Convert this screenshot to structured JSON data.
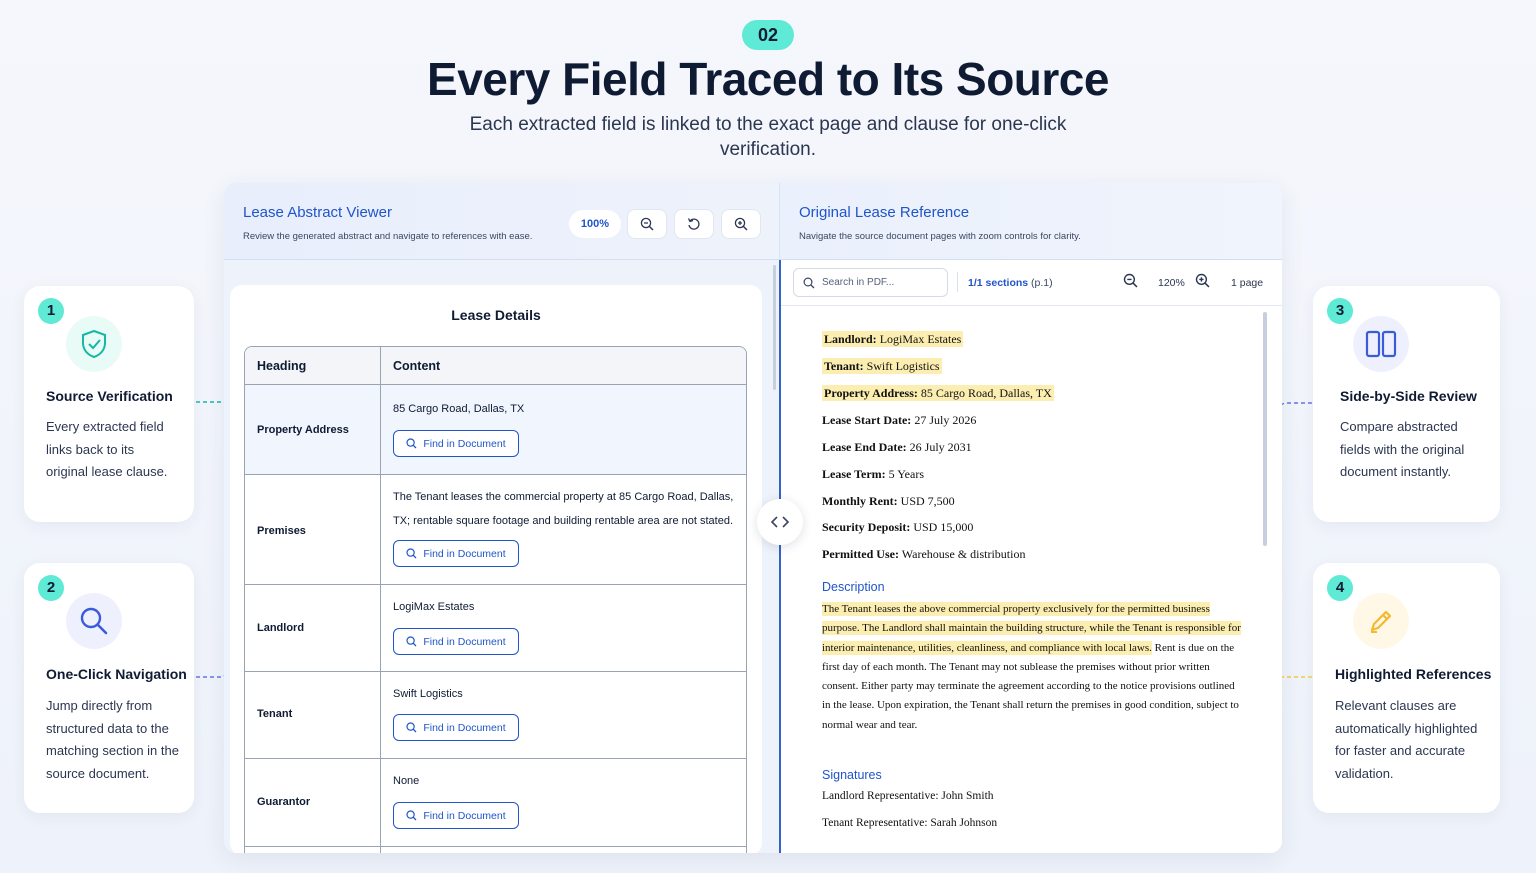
{
  "hero": {
    "badge": "02",
    "title": "Every Field Traced to Its Source",
    "subtitle": "Each extracted field is linked to the exact page and clause for one-click verification."
  },
  "features": [
    {
      "number": "1",
      "icon": "shield-check-icon",
      "title": "Source Verification",
      "description": "Every extracted field links back to its original lease clause."
    },
    {
      "number": "2",
      "icon": "search-icon",
      "title": "One-Click Navigation",
      "description": "Jump directly from structured data to the matching section in the source document."
    },
    {
      "number": "3",
      "icon": "columns-icon",
      "title": "Side-by-Side Review",
      "description": "Compare abstracted fields with the original document instantly."
    },
    {
      "number": "4",
      "icon": "highlighter-icon",
      "title": "Highlighted References",
      "description": "Relevant clauses are automatically highlighted for faster and accurate validation."
    }
  ],
  "viewer": {
    "title": "Lease Abstract Viewer",
    "subtitle": "Review the generated abstract and navigate to references with ease.",
    "zoom": "100%",
    "details_title": "Lease Details",
    "columns": [
      "Heading",
      "Content"
    ],
    "find_label": "Find in Document",
    "rows": [
      {
        "heading": "Property Address",
        "content": "85 Cargo Road, Dallas, TX"
      },
      {
        "heading": "Premises",
        "content": "The Tenant leases the commercial property at 85 Cargo Road, Dallas, TX; rentable square footage and building rentable area are not stated."
      },
      {
        "heading": "Landlord",
        "content": "LogiMax Estates"
      },
      {
        "heading": "Tenant",
        "content": "Swift Logistics"
      },
      {
        "heading": "Guarantor",
        "content": "None"
      }
    ]
  },
  "reference": {
    "title": "Original Lease Reference",
    "subtitle": "Navigate the source document pages with zoom controls for clarity.",
    "search_placeholder": "Search in PDF...",
    "sections": "1/1 sections",
    "sections_page": "(p.1)",
    "zoom": "120%",
    "pages": "1 page",
    "fields": [
      {
        "label": "Landlord:",
        "value": "LogiMax Estates"
      },
      {
        "label": "Tenant:",
        "value": "Swift Logistics"
      },
      {
        "label": "Property Address:",
        "value": "85 Cargo Road, Dallas, TX"
      },
      {
        "label": "Lease Start Date:",
        "value": "27 July 2026"
      },
      {
        "label": "Lease End Date:",
        "value": "26 July 2031"
      },
      {
        "label": "Lease Term:",
        "value": "5 Years"
      },
      {
        "label": "Monthly Rent:",
        "value": "USD 7,500"
      },
      {
        "label": "Security Deposit:",
        "value": "USD 15,000"
      },
      {
        "label": "Permitted Use:",
        "value": "Warehouse & distribution"
      }
    ],
    "description_heading": "Description",
    "description_highlighted": "The Tenant leases the above commercial property exclusively for the permitted business purpose. The Landlord shall maintain the building structure, while the Tenant is responsible for interior maintenance, utilities, cleanliness, and compliance with local laws.",
    "description_rest": "Rent is due on the first day of each month. The Tenant may not sublease the premises without prior written consent. Either party may terminate the agreement according to the notice provisions outlined in the lease. Upon expiration, the Tenant shall return the premises in good condition, subject to normal wear and tear.",
    "signatures_heading": "Signatures",
    "signatures": [
      "Landlord Representative: John Smith",
      "Tenant Representative: Sarah Johnson"
    ]
  },
  "colors": {
    "accent": "#1f55c9",
    "badge": "#5eead4",
    "highlight": "#fbeeb0"
  }
}
